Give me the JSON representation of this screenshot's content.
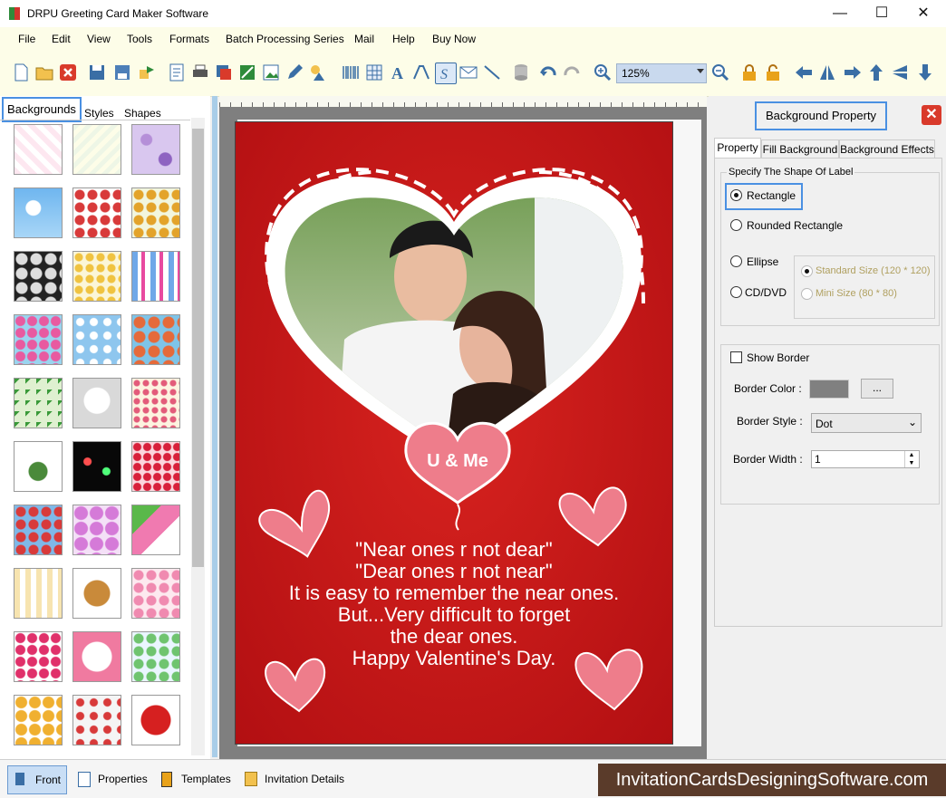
{
  "window": {
    "title": "DRPU Greeting Card Maker Software",
    "minimize": "—",
    "maximize": "☐",
    "close": "✕"
  },
  "menu": [
    "File",
    "Edit",
    "View",
    "Tools",
    "Formats",
    "Batch Processing Series",
    "Mail",
    "Help",
    "Buy Now"
  ],
  "toolbar": {
    "zoom_value": "125%"
  },
  "left_panel": {
    "tabs": [
      "Backgrounds",
      "Styles",
      "Shapes"
    ]
  },
  "card": {
    "badge": "U & Me",
    "poem": [
      "\"Near ones r not dear\"",
      "\"Dear ones r not near\"",
      "It is easy to remember the near ones.",
      "But...Very difficult to forget",
      "the dear ones.",
      "Happy Valentine's Day."
    ]
  },
  "right_panel": {
    "title": "Background Property",
    "tabs": [
      "Property",
      "Fill Background",
      "Background Effects"
    ],
    "shape_group_label": "Specify The Shape Of Label",
    "shapes": {
      "rectangle": "Rectangle",
      "rounded": "Rounded Rectangle",
      "ellipse": "Ellipse",
      "cd": "CD/DVD"
    },
    "sizes": {
      "standard": "Standard Size (120 * 120)",
      "mini": "Mini Size (80 * 80)"
    },
    "show_border": "Show Border",
    "border_color_label": "Border Color :",
    "border_color_btn": "...",
    "border_color": "#808080",
    "border_style_label": "Border Style :",
    "border_style_value": "Dot",
    "border_width_label": "Border Width :",
    "border_width_value": "1"
  },
  "bottom_bar": {
    "front": "Front",
    "properties": "Properties",
    "templates": "Templates",
    "invitation": "Invitation Details"
  },
  "watermark": "InvitationCardsDesigningSoftware.com",
  "colors": {
    "card_red": "#c6161a",
    "accent": "#4a90e2",
    "heart_pink": "#ee7d8b"
  }
}
